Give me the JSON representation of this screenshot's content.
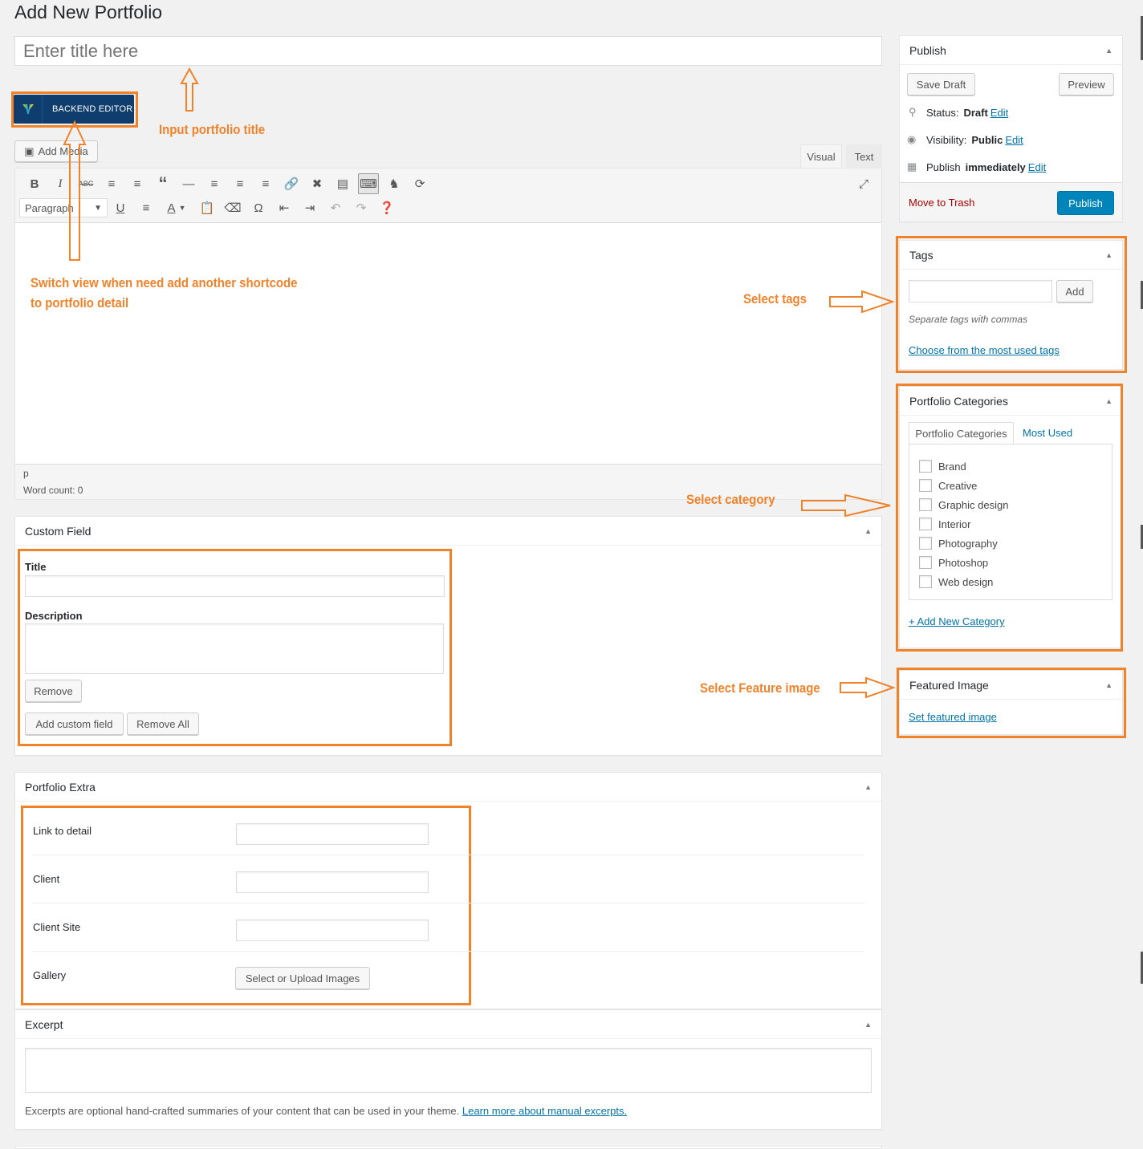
{
  "page": {
    "heading": "Add New Portfolio"
  },
  "title_input": {
    "placeholder": "Enter title here"
  },
  "backend_editor": {
    "label": "BACKEND EDITOR"
  },
  "editor": {
    "add_media": "Add Media",
    "tabs": [
      "Visual",
      "Text"
    ],
    "format_select": "Paragraph",
    "path": "p",
    "word_count": "Word count: 0"
  },
  "annotations": {
    "input_title": "Input portfolio title",
    "switch_view_line1": "Switch view when need add another shortcode",
    "switch_view_line2": "to portfolio detail",
    "select_tags": "Select tags",
    "select_category": "Select category",
    "select_feature": "Select Feature image"
  },
  "custom_field": {
    "title": "Custom Field",
    "field_title": "Title",
    "field_description": "Description",
    "remove": "Remove",
    "add_custom_field": "Add custom field",
    "remove_all": "Remove All"
  },
  "portfolio_extra": {
    "title": "Portfolio Extra",
    "rows": [
      "Link to detail",
      "Client",
      "Client Site",
      "Gallery"
    ],
    "gallery_button": "Select or Upload Images"
  },
  "excerpt": {
    "title": "Excerpt",
    "help": "Excerpts are optional hand-crafted summaries of your content that can be used in your theme.",
    "help_link": "Learn more about manual excerpts."
  },
  "publish": {
    "title": "Publish",
    "save_draft": "Save Draft",
    "preview": "Preview",
    "status_label": "Status:",
    "status_value": "Draft",
    "visibility_label": "Visibility:",
    "visibility_value": "Public",
    "publish_label": "Publish",
    "publish_value": "immediately",
    "edit": "Edit",
    "move_to_trash": "Move to Trash",
    "publish_button": "Publish"
  },
  "tags": {
    "title": "Tags",
    "add": "Add",
    "hint": "Separate tags with commas",
    "choose": "Choose from the most used tags"
  },
  "categories": {
    "title": "Portfolio Categories",
    "tab_all": "Portfolio Categories",
    "tab_most_used": "Most Used",
    "items": [
      "Brand",
      "Creative",
      "Graphic design",
      "Interior",
      "Photography",
      "Photoshop",
      "Web design"
    ],
    "add_new": "+ Add New Category"
  },
  "featured_image": {
    "title": "Featured Image",
    "set": "Set featured image"
  },
  "colors": {
    "accent": "#f0822a",
    "primary": "#0085ba",
    "link": "#0073aa",
    "trash": "#a00"
  }
}
